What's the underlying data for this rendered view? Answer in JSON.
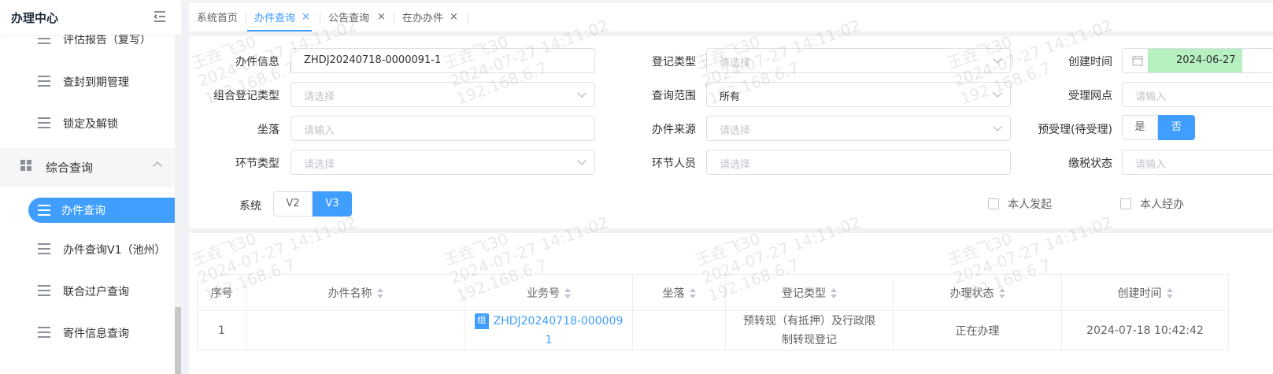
{
  "sidebar": {
    "title": "办理中心",
    "items_top": [
      {
        "label": "评估报告（复写）"
      },
      {
        "label": "查封到期管理"
      },
      {
        "label": "锁定及解锁"
      }
    ],
    "group": {
      "label": "综合查询"
    },
    "items_sub": [
      {
        "label": "办件查询",
        "active": true
      },
      {
        "label": "办件查询V1（池州）"
      },
      {
        "label": "联合过户查询"
      },
      {
        "label": "寄件信息查询"
      }
    ]
  },
  "tabs": [
    {
      "label": "系统首页",
      "closable": false
    },
    {
      "label": "办件查询",
      "closable": true,
      "active": true
    },
    {
      "label": "公告查询",
      "closable": true
    },
    {
      "label": "在办办件",
      "closable": true
    }
  ],
  "filters": {
    "doc_info": {
      "label": "办件信息",
      "value": "ZHDJ20240718-0000091-1"
    },
    "reg_type": {
      "label": "登记类型",
      "placeholder": "请选择"
    },
    "created_time": {
      "label": "创建时间",
      "value": "2024-06-27"
    },
    "combo_reg_type": {
      "label": "组合登记类型",
      "placeholder": "请选择"
    },
    "query_scope": {
      "label": "查询范围",
      "value": "所有"
    },
    "accept_point": {
      "label": "受理网点",
      "placeholder": "请输入"
    },
    "location": {
      "label": "坐落",
      "placeholder": "请输入"
    },
    "doc_source": {
      "label": "办件来源",
      "placeholder": "请选择"
    },
    "pre_accept": {
      "label": "预受理(待受理)",
      "options": [
        "是",
        "否"
      ],
      "selected": "否"
    },
    "step_type": {
      "label": "环节类型",
      "placeholder": "请选择"
    },
    "step_person": {
      "label": "环节人员",
      "placeholder": "请选择"
    },
    "tax_status": {
      "label": "缴税状态",
      "placeholder": "请输入"
    },
    "system": {
      "label": "系统",
      "options": [
        "V2",
        "V3"
      ],
      "selected": "V3"
    },
    "self_initiated": {
      "label": "本人发起",
      "checked": false
    },
    "self_handled": {
      "label": "本人经办",
      "checked": false
    }
  },
  "table": {
    "columns": [
      "序号",
      "办件名称",
      "业务号",
      "坐落",
      "登记类型",
      "办理状态",
      "创建时间"
    ],
    "rows": [
      {
        "index": "1",
        "name": "",
        "badge": "组",
        "bizno_line1": "ZHDJ20240718-000009",
        "bizno_line2": "1",
        "location": "",
        "reg_type_line1": "预转现（有抵押）及行政限",
        "reg_type_line2": "制转现登记",
        "status": "正在办理",
        "created": "2024-07-18 10:42:42"
      }
    ]
  },
  "watermark": {
    "line1": "王垚飞30",
    "line2": "2024-07-27 14:11:02",
    "line3": "192.168.6.7"
  },
  "colors": {
    "accent": "#409eff",
    "date_highlight": "#b7f0c0"
  }
}
